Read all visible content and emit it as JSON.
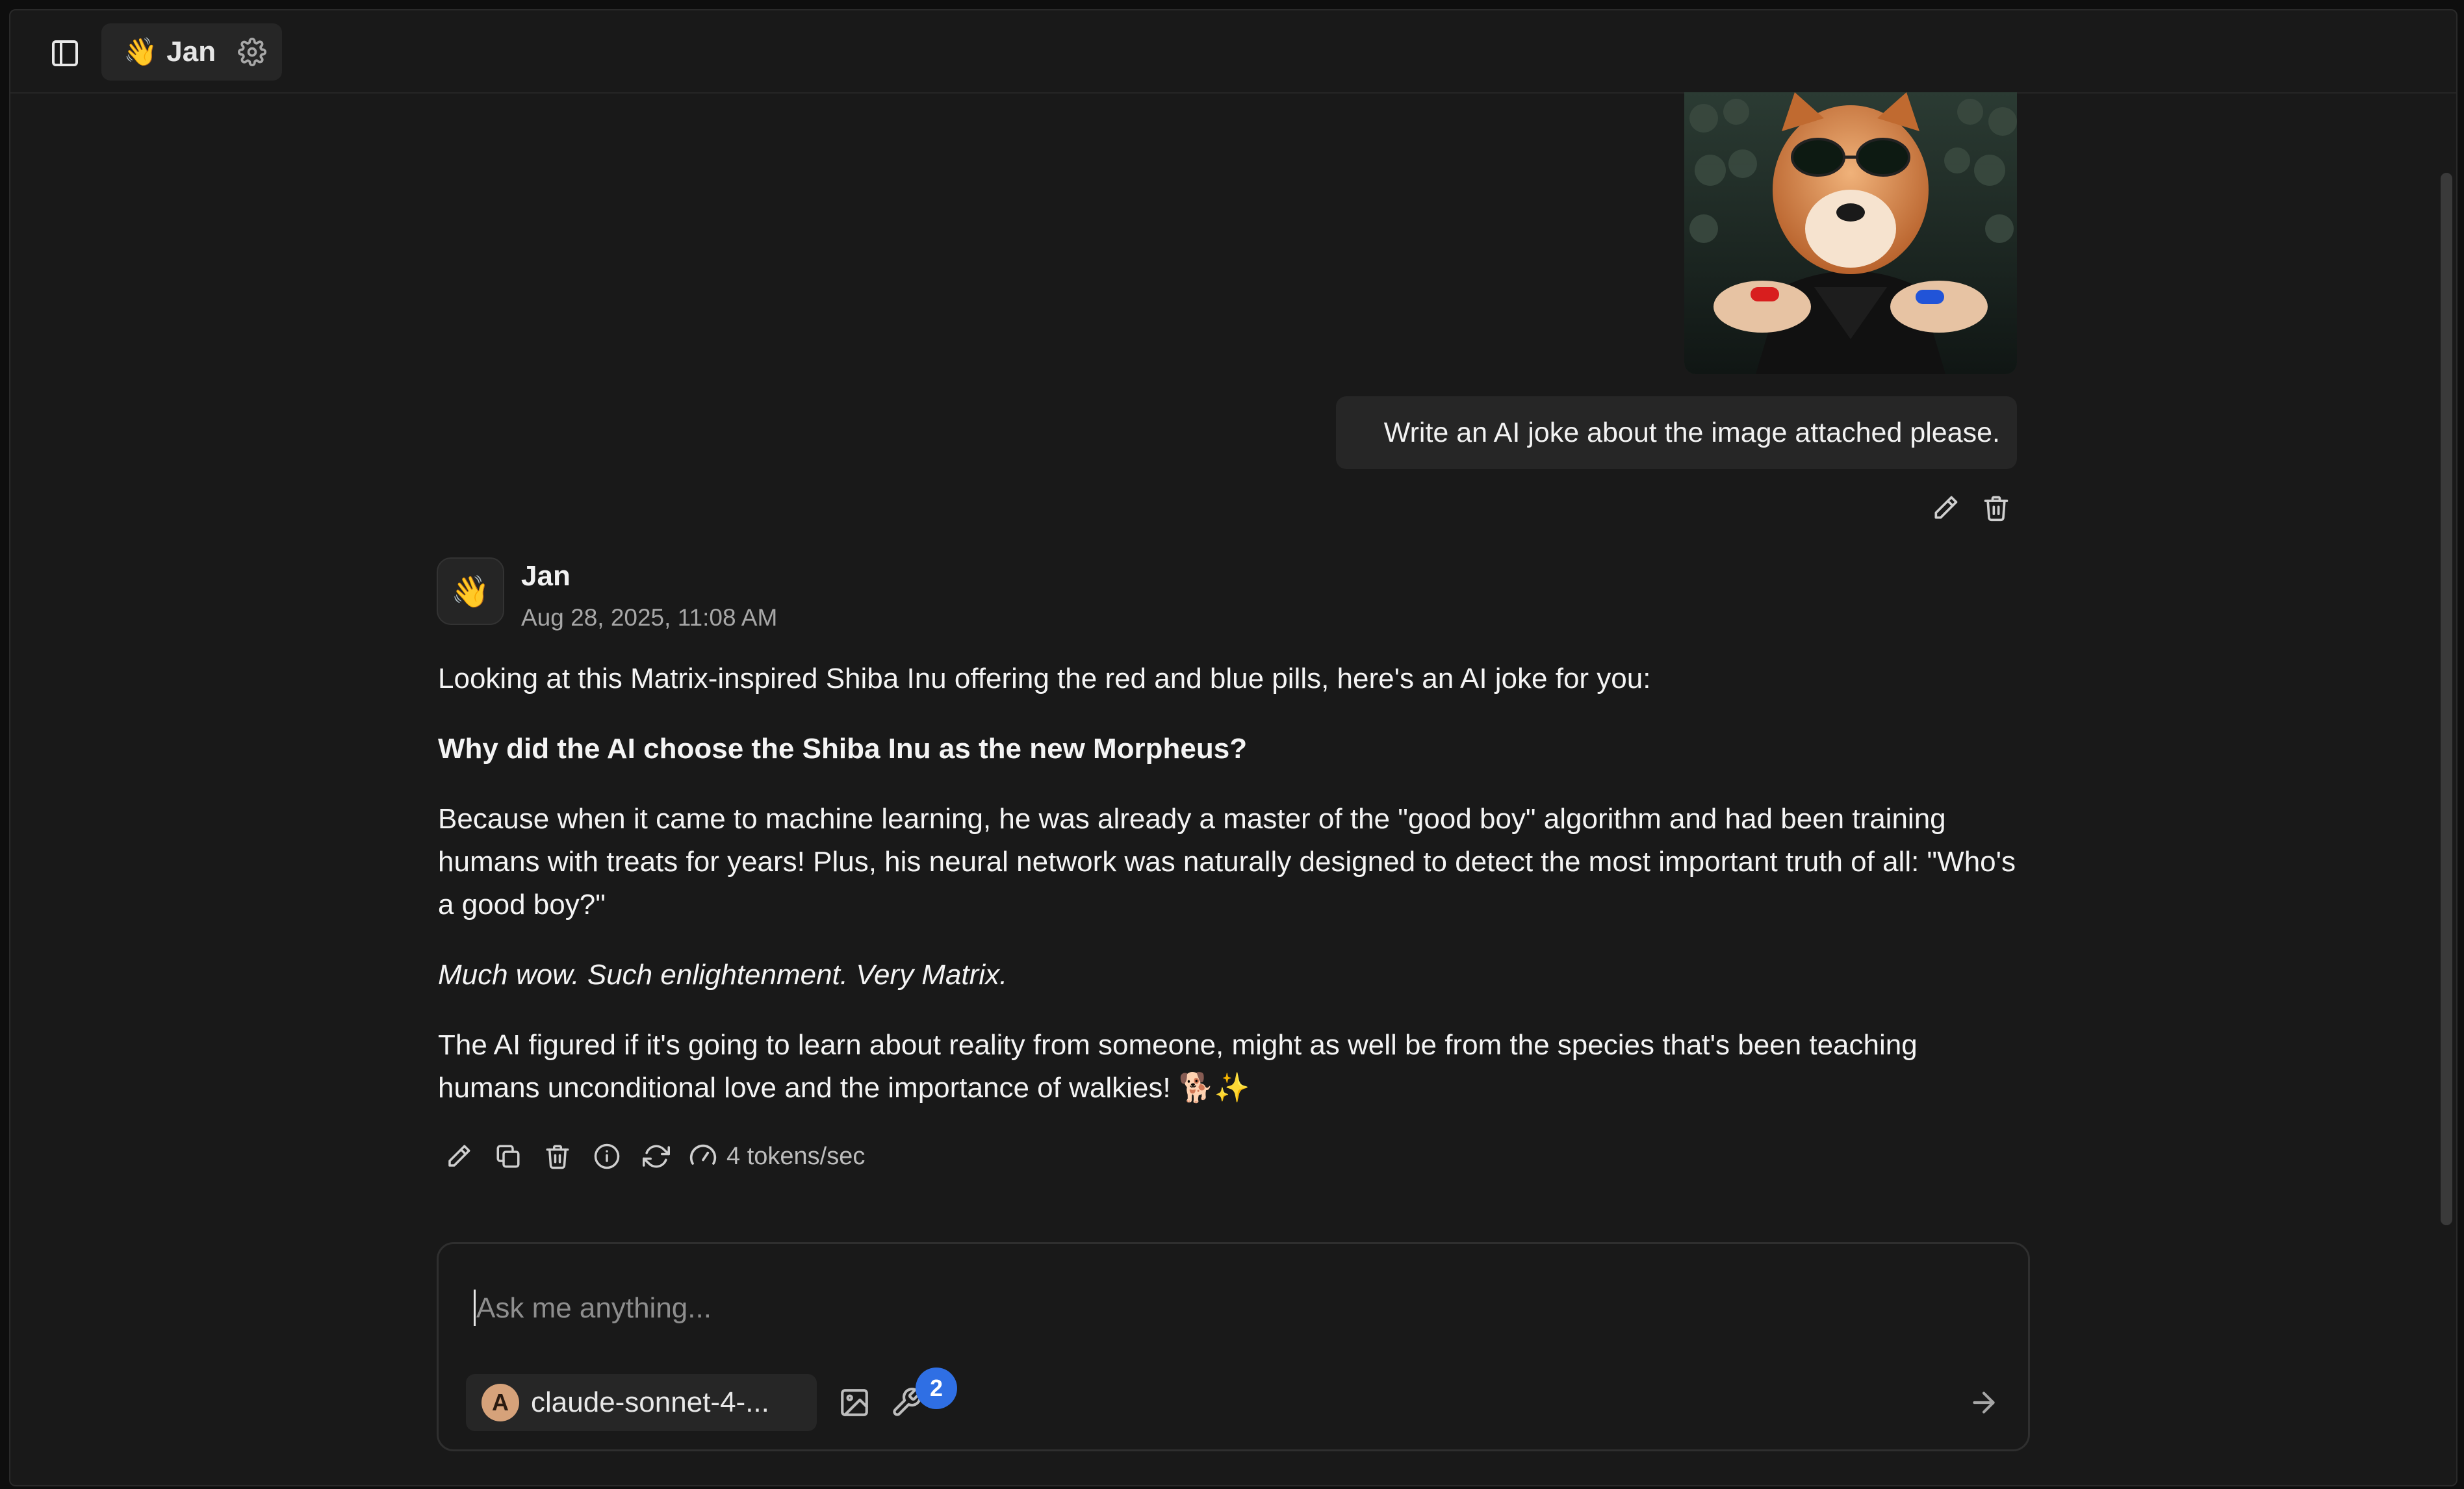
{
  "header": {
    "assistant_emoji": "👋",
    "assistant_name": "Jan"
  },
  "user_message": {
    "text": "Write an AI joke about the image attached please.",
    "image_alt": "Matrix-inspired Shiba Inu offering red and blue pills"
  },
  "assistant_message": {
    "avatar_emoji": "👋",
    "author": "Jan",
    "timestamp": "Aug 28, 2025, 11:08 AM",
    "paragraphs": {
      "p1": "Looking at this Matrix-inspired Shiba Inu offering the red and blue pills, here's an AI joke for you:",
      "p2": "Why did the AI choose the Shiba Inu as the new Morpheus?",
      "p3": "Because when it came to machine learning, he was already a master of the \"good boy\" algorithm and had been training humans with treats for years! Plus, his neural network was naturally designed to detect the most important truth of all: \"Who's a good boy?\"",
      "p4": "Much wow. Such enlightenment. Very Matrix.",
      "p5": "The AI figured if it's going to learn about reality from someone, might as well be from the species that's been teaching humans unconditional love and the importance of walkies! 🐕✨"
    },
    "speed": "4 tokens/sec"
  },
  "composer": {
    "placeholder": "Ask me anything...",
    "model_logo": "A",
    "model_name": "claude-sonnet-4-...",
    "tools_count": "2"
  },
  "colors": {
    "background": "#191919",
    "surface": "#262626",
    "badge": "#2f6fe4",
    "model_logo": "#d6a27a"
  },
  "icons": [
    "sidebar-toggle-icon",
    "gear-icon",
    "pencil-icon",
    "trash-icon",
    "copy-icon",
    "info-icon",
    "refresh-icon",
    "gauge-icon",
    "image-icon",
    "wrench-icon",
    "arrow-right-icon"
  ]
}
